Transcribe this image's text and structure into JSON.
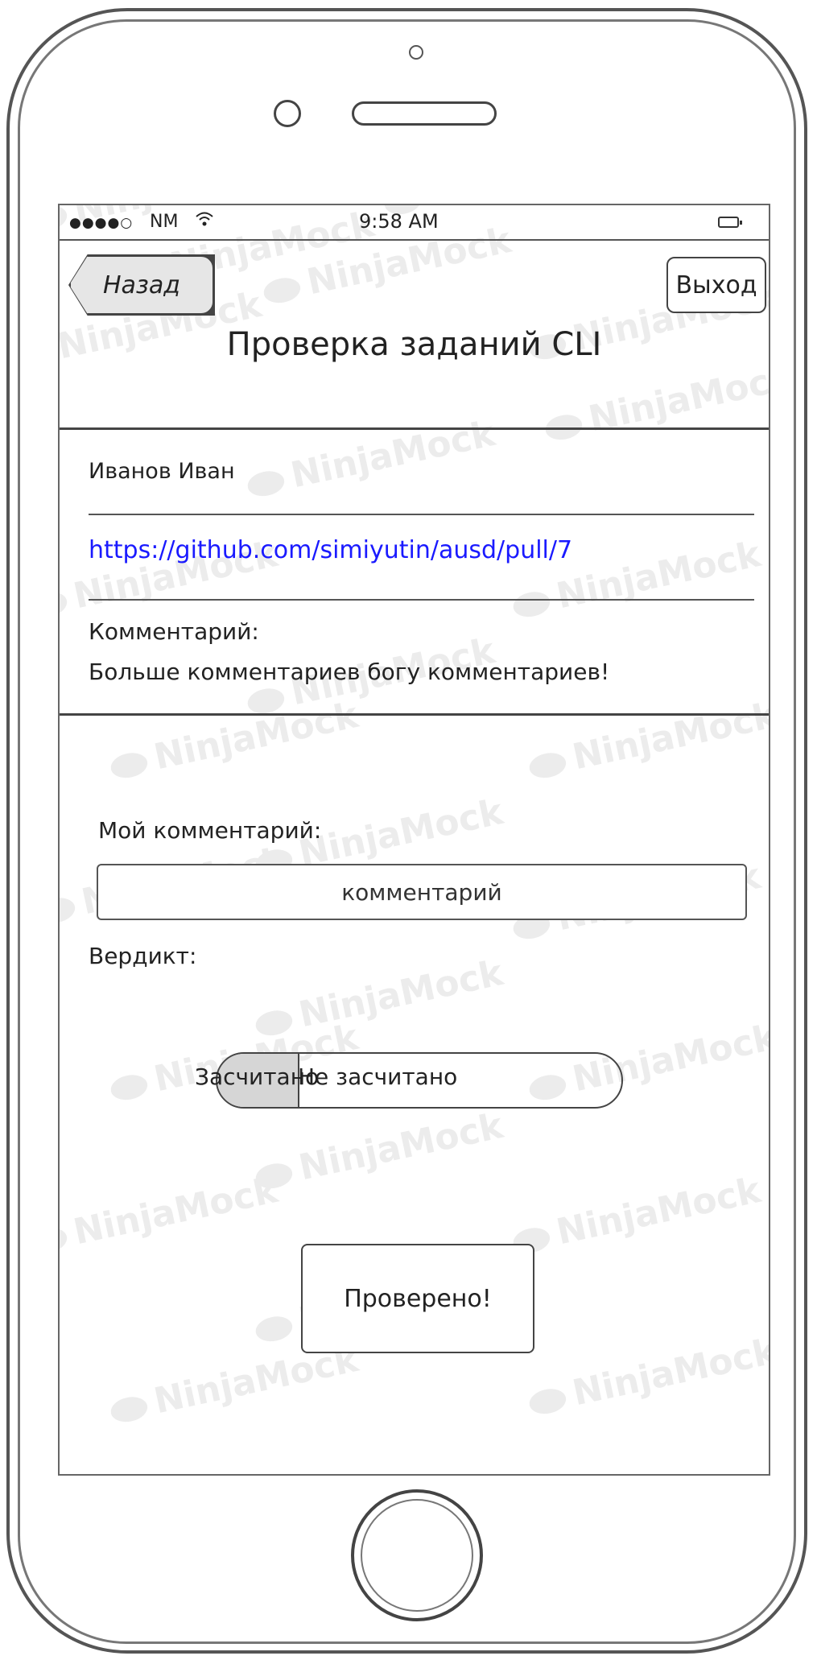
{
  "status_bar": {
    "signal": "●●●●○",
    "carrier": "NM",
    "time": "9:58 AM"
  },
  "nav": {
    "back_label": "Назад",
    "logout_label": "Выход"
  },
  "page_title": "Проверка заданий CLI",
  "submission": {
    "student_name": "Иванов Иван",
    "link": "https://github.com/simiyutin/ausd/pull/7",
    "comment_label": "Комментарий:",
    "comment_text": "Больше комментариев богу комментариев!"
  },
  "review": {
    "my_comment_label": "Мой комментарий:",
    "my_comment_placeholder": "комментарий",
    "verdict_label": "Вердикт:",
    "verdict_options": [
      "Засчитано",
      "Не засчитано"
    ],
    "verdict_selected": "Засчитано",
    "submit_label": "Проверено!"
  },
  "watermark_text": "NinjaMock",
  "icons": {
    "wifi": "wifi-icon",
    "battery": "battery-icon"
  }
}
